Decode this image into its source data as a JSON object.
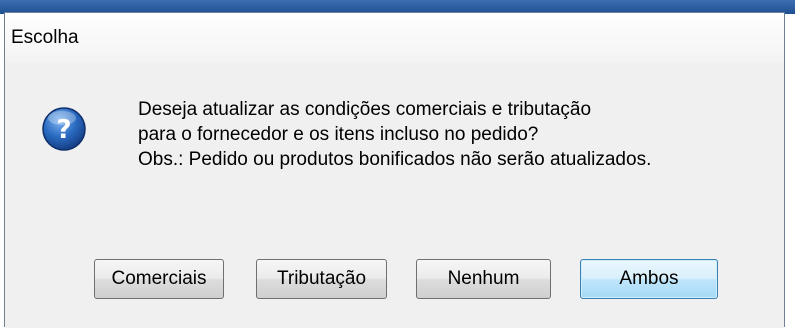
{
  "window": {
    "title": "Escolha"
  },
  "dialog": {
    "icon": "question-icon",
    "message_lines": [
      "Deseja atualizar as condições comerciais e tributação",
      "para o fornecedor e os itens incluso no pedido?",
      "Obs.: Pedido ou produtos bonificados não serão atualizados."
    ]
  },
  "buttons": {
    "comerciais": "Comerciais",
    "tributacao": "Tributação",
    "nenhum": "Nenhum",
    "ambos": "Ambos"
  },
  "colors": {
    "dialog_background": "#f0f0f0",
    "default_button_border": "#3c7fb1",
    "icon_blue": "#1f5fae"
  }
}
